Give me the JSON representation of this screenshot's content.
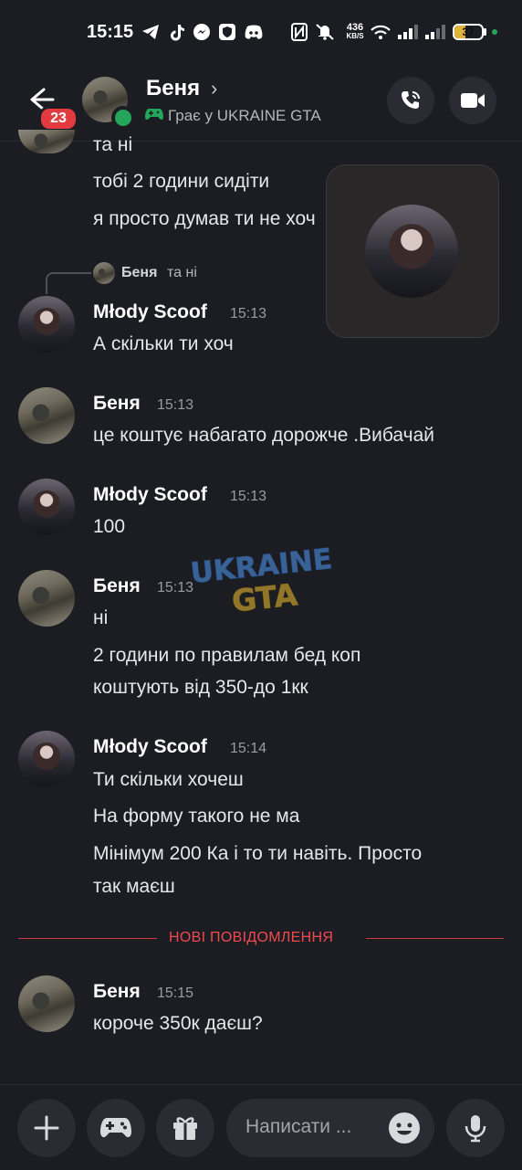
{
  "status_bar": {
    "time": "15:15",
    "net_speed_value": "436",
    "net_speed_unit": "KB/S",
    "battery": "37",
    "icons": [
      "telegram-icon",
      "tiktok-icon",
      "messenger-icon",
      "vpn-shield-icon",
      "discord-icon",
      "nfc-icon",
      "mute-icon",
      "wifi-icon",
      "signal-icon",
      "signal-icon",
      "battery-icon"
    ]
  },
  "header": {
    "unread_badge": "23",
    "name": "Беня",
    "chevron": "›",
    "activity": "Грає у UKRAINE GTA"
  },
  "messages": {
    "top_group": {
      "lines": [
        "та ні",
        "тобі 2 години сидіти",
        "я просто думав ти не хоч"
      ]
    },
    "reply_preview": {
      "author": "Беня",
      "text": "та ні"
    },
    "m1": {
      "author": "Młody Scoof",
      "time": "15:13",
      "lines": [
        "А скільки ти хоч"
      ]
    },
    "m2": {
      "author": "Беня",
      "time": "15:13",
      "lines": [
        "це коштує набагато дорожче .Вибачай"
      ]
    },
    "m3": {
      "author": "Młody Scoof",
      "time": "15:13",
      "lines": [
        "100"
      ]
    },
    "m4": {
      "author": "Беня",
      "time": "15:13",
      "lines": [
        "ні",
        "2 години по правилам бед коп",
        "коштують від 350-до 1кк"
      ]
    },
    "m5": {
      "author": "Młody Scoof",
      "time": "15:14",
      "lines": [
        "Ти скільки хочеш",
        "На форму такого не ма",
        "Мінімум 200 Ка і то ти навіть. Просто",
        "так маєш"
      ]
    },
    "divider": "НОВІ ПОВІДОМЛЕННЯ",
    "m6": {
      "author": "Беня",
      "time": "15:15",
      "lines": [
        "короче 350к даєш?"
      ]
    }
  },
  "watermark": {
    "line1": "UKRAINE",
    "line2": "GTA"
  },
  "input": {
    "placeholder": "Написати ..."
  },
  "colors": {
    "background": "#1c1c23",
    "online": "#23a55a",
    "badge": "#e13a3f",
    "divider": "#f04a4e",
    "game": "#23a55a"
  }
}
